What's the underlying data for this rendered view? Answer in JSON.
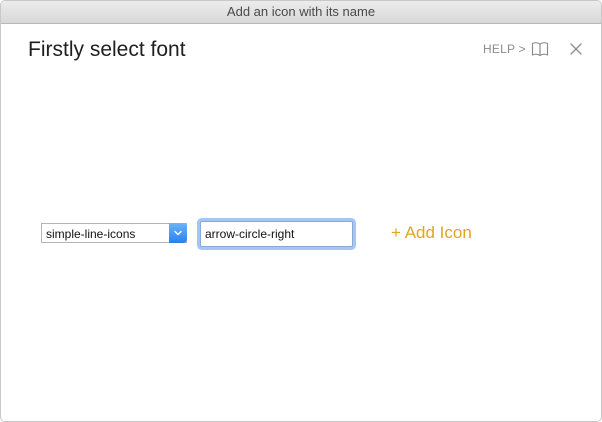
{
  "window": {
    "title": "Add an icon with its name"
  },
  "header": {
    "heading": "Firstly select font",
    "help_label": "HELP >"
  },
  "form": {
    "font_select_value": "simple-line-icons",
    "icon_name_value": "arrow-circle-right",
    "add_button_label": "+ Add Icon"
  },
  "icons": {
    "help_book": "book-icon",
    "close": "close-icon",
    "select_arrow": "chevron-updown-icon"
  },
  "colors": {
    "accent": "#e0a526",
    "select_arrow_bg": "#2a7ff0",
    "focus_ring": "#a3c7f5"
  }
}
